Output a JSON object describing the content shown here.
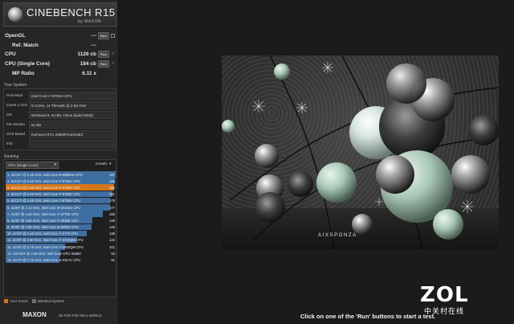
{
  "app": {
    "title": "CINEBENCH R15",
    "subtitle": "by MAXON"
  },
  "results": [
    {
      "label": "OpenGL",
      "value": "---",
      "button": "Run",
      "mark": "box"
    },
    {
      "label": "Ref. Match",
      "value": "---",
      "button": "",
      "mark": ""
    },
    {
      "label": "CPU",
      "value": "1126 cb",
      "button": "Run",
      "mark": "check"
    },
    {
      "label": "CPU (Single Core)",
      "value": "184 cb",
      "button": "Run",
      "mark": "check"
    },
    {
      "label": "MP Ratio",
      "value": "6.11 x",
      "button": "",
      "mark": ""
    }
  ],
  "system": {
    "header": "Your System",
    "rows": [
      {
        "key": "Processor",
        "value": "Intel Core i7-9750H CPU"
      },
      {
        "key": "Cores x GHz",
        "value": "6 Cores, 12 Threads @ 2.60 GHz"
      },
      {
        "key": "OS",
        "value": "Windows 8, 64 Bit, China (build 9200)"
      },
      {
        "key": "CB Version",
        "value": "64 Bit"
      },
      {
        "key": "GFX Board",
        "value": "GeForce RTX 2060/PCIe/SSE2"
      },
      {
        "key": "Info",
        "value": ""
      }
    ]
  },
  "ranking": {
    "header": "Ranking",
    "selected": "CPU (Single Core)",
    "details_label": "Details",
    "items": [
      {
        "text": "1. 4C/12T @ 2.40 GHz, Intel Core i9-9880HK CPU",
        "score": "187",
        "pct": 100,
        "mine": false
      },
      {
        "text": "2. 6C/12T @ 2.60 GHz, Intel Core i7-9750H CPU",
        "score": "186",
        "pct": 99.5,
        "mine": false
      },
      {
        "text": "3. 6C/12T @ 2.60 GHz, Intel Core i7-9750H CPU",
        "score": "184",
        "pct": 98.4,
        "mine": true
      },
      {
        "text": "4. 6C/12T @ 2.60 GHz, Intel Core i7-9750H CPU",
        "score": "181",
        "pct": 96.8,
        "mine": false
      },
      {
        "text": "5. 6C/12T @ 2.60 GHz, Intel Core i7-9750H CPU",
        "score": "178",
        "pct": 95.2,
        "mine": false
      },
      {
        "text": "6. 4C/8T @ 2.12 GHz, Intel Core i5-10210U CPU",
        "score": "177",
        "pct": 94.7,
        "mine": false
      },
      {
        "text": "7. 4C/8T @ 4.40 GHz, Intel Core i7-4770K CPU",
        "score": "165",
        "pct": 88.2,
        "mine": false
      },
      {
        "text": "8. 4C/8T @ 3.50 GHz, Intel Core i7-3930K CPU",
        "score": "148",
        "pct": 79.1,
        "mine": false
      },
      {
        "text": "9. 4C/8T @ 1.80 GHz, Intel Core i5-8250U CPU",
        "score": "146",
        "pct": 78.1,
        "mine": false
      },
      {
        "text": "10. 4C/8T @ 3.40 GHz, Intel Core i7-3770 CPU",
        "score": "138",
        "pct": 73.8,
        "mine": false
      },
      {
        "text": "11. 4C/8T @ 2.60 GHz, Intel Core i7-3720QM CPU",
        "score": "122",
        "pct": 65.2,
        "mine": false
      },
      {
        "text": "12. 4C/8T @ 2.79 GHz, Intel Core i7-3840QM CPU",
        "score": "101",
        "pct": 54,
        "mine": false
      },
      {
        "text": "13. 12C/24T @ 2.66 GHz, Intel Xeon CPU X5650",
        "score": "93",
        "pct": 49.7,
        "mine": false
      },
      {
        "text": "14. 2C/4T @ 1.70 GHz, Intel Core i5-3317U CPU",
        "score": "91",
        "pct": 48.7,
        "mine": false
      }
    ]
  },
  "legend": {
    "your_score": "Your Score",
    "identical": "Identical System",
    "your_color": "#d4761b",
    "identical_color": "#6e6e6e"
  },
  "footer": {
    "brand": "MAXON",
    "tagline": "3D FOR THE REAL WORLD"
  },
  "render": {
    "watermark": "AIXSPONZA"
  },
  "status": "Click on one of the 'Run' buttons to start a test.",
  "overlay": {
    "brand": "ZOL",
    "sub": "中关村在线"
  },
  "colors": {
    "bar": "#3f6ea1",
    "highlight": "#d4761b"
  }
}
